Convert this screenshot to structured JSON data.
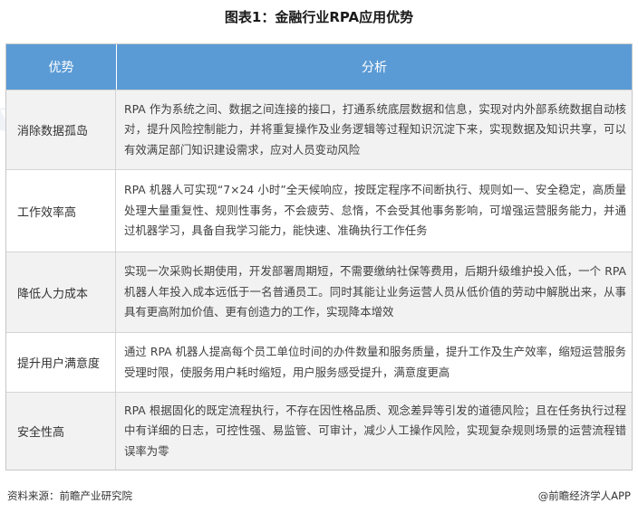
{
  "title": "图表1：金融行业RPA应用优势",
  "header": {
    "col_advantage": "优势",
    "col_analysis": "分析"
  },
  "rows": [
    {
      "advantage": "消除数据孤岛",
      "analysis": "RPA 作为系统之间、数据之间连接的接口，打通系统底层数据和信息，实现对内外部系统数据自动核对，提升风险控制能力，并将重复操作及业务逻辑等过程知识沉淀下来，实现数据及知识共享，可以有效满足部门知识建设需求，应对人员变动风险"
    },
    {
      "advantage": "工作效率高",
      "analysis": "RPA 机器人可实现“7×24 小时”全天候响应，按既定程序不间断执行、规则如一、安全稳定，高质量处理大量重复性、规则性事务，不会疲劳、怠惰，不会受其他事务影响，可增强运营服务能力，并通过机器学习，具备自我学习能力，能快速、准确执行工作任务"
    },
    {
      "advantage": "降低人力成本",
      "analysis": "实现一次采购长期使用，开发部署周期短，不需要缴纳社保等费用，后期升级维护投入低，一个 RPA 机器人年投入成本远低于一名普通员工。同时其能让业务运营人员从低价值的劳动中解脱出来，从事具有更高附加价值、更有创造力的工作，实现降本增效"
    },
    {
      "advantage": "提升用户满意度",
      "analysis": "通过 RPA 机器人提高每个员工单位时间的办件数量和服务质量，提升工作及生产效率，缩短运营服务受理时限，使服务用户耗时缩短，用户服务感受提升，满意度更高"
    },
    {
      "advantage": "安全性高",
      "analysis": "RPA 根据固化的既定流程执行，不存在因性格品质、观念差异等引发的道德风险；且在任务执行过程中有详细的日志，可控性强、易监管、可审计，减少人工操作风险，实现复杂规则场景的运营流程错误率为零"
    }
  ],
  "footer": {
    "source": "资料来源：前瞻产业研究院",
    "credit": "@前瞻经济学人APP"
  },
  "colors": {
    "header_bg": "#5b9bd5",
    "row_alt_bg": "#f2f2f2",
    "border": "#d4d4d4"
  }
}
